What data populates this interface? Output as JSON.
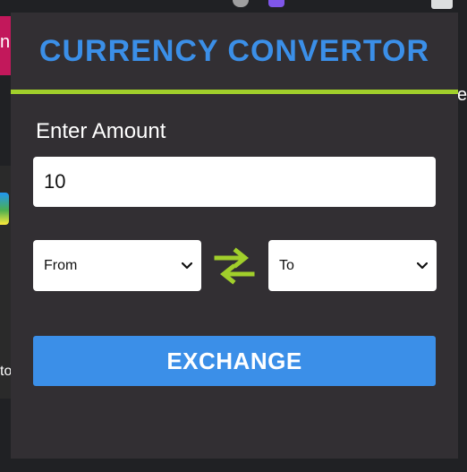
{
  "background": {
    "left_letter": "n",
    "left_text": "to",
    "right_letter": "e"
  },
  "app": {
    "title": "CURRENCY CONVERTOR"
  },
  "amount": {
    "label": "Enter Amount",
    "value": "10"
  },
  "from_select": {
    "selected": "From"
  },
  "to_select": {
    "selected": "To"
  },
  "exchange_button": {
    "label": "EXCHANGE"
  },
  "icons": {
    "swap": "swap-arrows-icon",
    "chevron": "chevron-down-icon"
  },
  "colors": {
    "panel_background": "#322f33",
    "title": "#3b8fe8",
    "accent_bar": "#a1cf2b",
    "swap_icon": "#a1cf2b",
    "button": "#3b8fe8",
    "button_text": "#ffffff",
    "label_text": "#ffffff"
  }
}
